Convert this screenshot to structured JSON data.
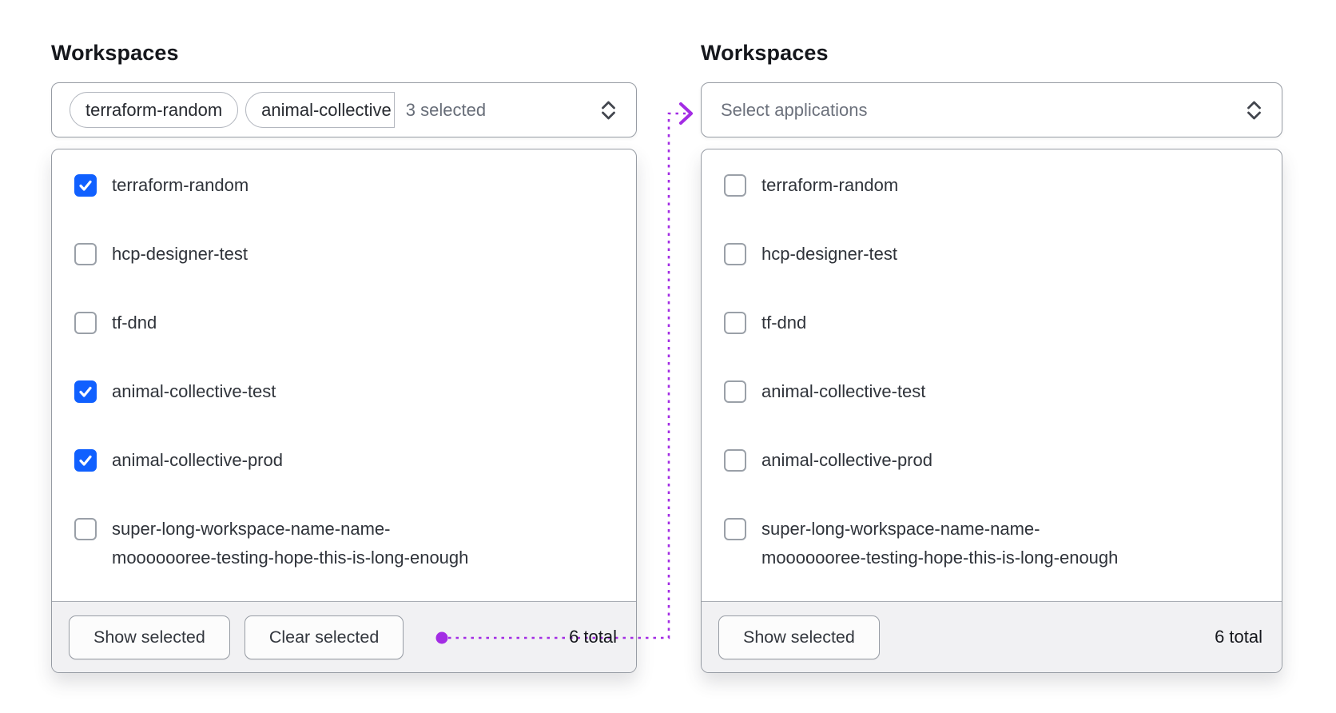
{
  "colors": {
    "checkbox_checked_blue": "#1060ff",
    "arrow_purple": "#a32ce4"
  },
  "panels": [
    {
      "label": "Workspaces",
      "toggle": {
        "tags": [
          "terraform-random",
          "animal-collective"
        ],
        "summary": "3 selected"
      },
      "items": [
        {
          "label": "terraform-random",
          "checked": true
        },
        {
          "label": "hcp-designer-test",
          "checked": false
        },
        {
          "label": "tf-dnd",
          "checked": false
        },
        {
          "label": "animal-collective-test",
          "checked": true
        },
        {
          "label": "animal-collective-prod",
          "checked": true
        },
        {
          "label": "super-long-workspace-name-name-\nmooooooree-testing-hope-this-is-long-enough",
          "checked": false
        }
      ],
      "footer": {
        "buttons": [
          "Show selected",
          "Clear selected"
        ],
        "total": "6 total"
      }
    },
    {
      "label": "Workspaces",
      "toggle": {
        "placeholder": "Select applications"
      },
      "items": [
        {
          "label": "terraform-random",
          "checked": false
        },
        {
          "label": "hcp-designer-test",
          "checked": false
        },
        {
          "label": "tf-dnd",
          "checked": false
        },
        {
          "label": "animal-collective-test",
          "checked": false
        },
        {
          "label": "animal-collective-prod",
          "checked": false
        },
        {
          "label": "super-long-workspace-name-name-\nmooooooree-testing-hope-this-is-long-enough",
          "checked": false
        }
      ],
      "footer": {
        "buttons": [
          "Show selected"
        ],
        "total": "6 total"
      }
    }
  ]
}
